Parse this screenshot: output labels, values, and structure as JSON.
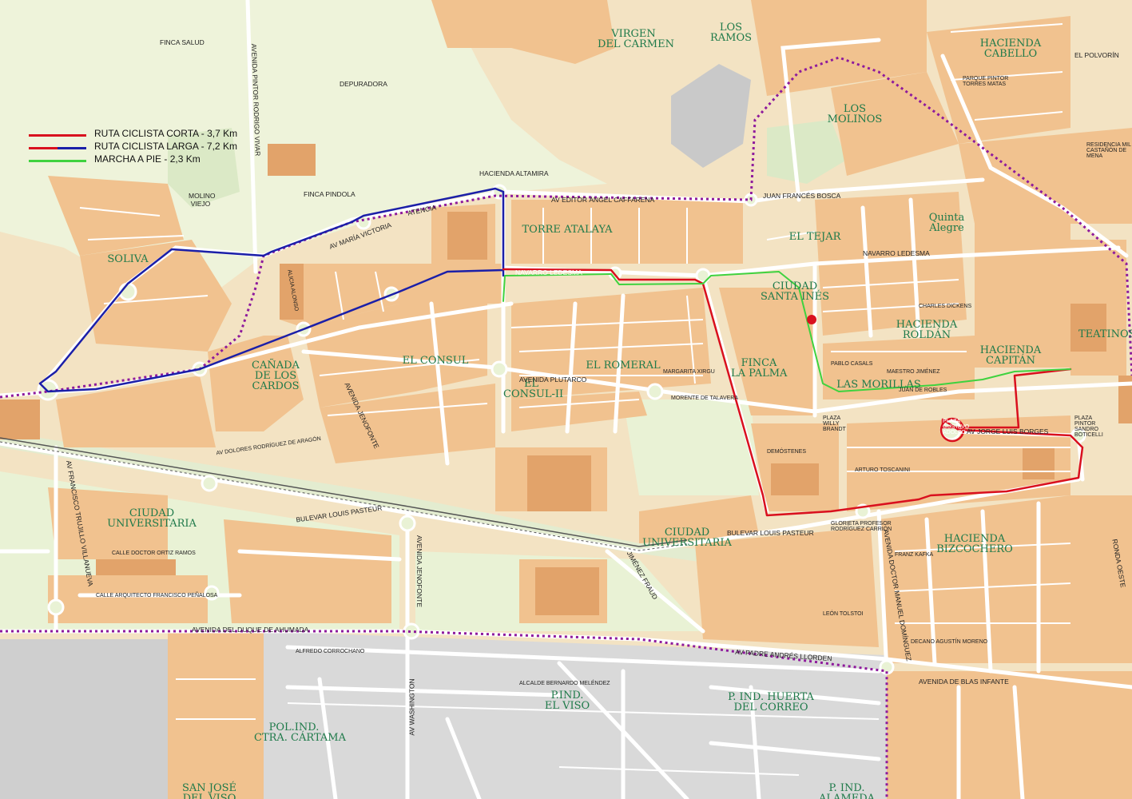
{
  "legend": {
    "items": [
      {
        "label": "RUTA CICLISTA CORTA - 3,7 Km",
        "color": "#d9101e"
      },
      {
        "label": "RUTA CICLISTA LARGA - 7,2 Km",
        "color": "#1b1fa8",
        "color2": "#d9101e"
      },
      {
        "label": "MARCHA A PIE - 2,3 Km",
        "color": "#3fd23f"
      }
    ]
  },
  "colors": {
    "block": "#f1c28f",
    "street": "#ffffff",
    "park": "#e9f2d5",
    "industrial": "#d9d9d9",
    "boundary": "#8e1a9c",
    "district_text": "#1f7a4a",
    "short_route": "#d9101e",
    "long_route": "#1b1fa8",
    "walk_route": "#3fd23f"
  },
  "districts": [
    {
      "name": "VIRGEN\nDEL CARMEN"
    },
    {
      "name": "LOS\nRAMOS"
    },
    {
      "name": "HACIENDA\nCABELLO"
    },
    {
      "name": "LOS\nMOLINOS"
    },
    {
      "name": "SOLIVA"
    },
    {
      "name": "TORRE ATALAYA"
    },
    {
      "name": "EL TEJAR"
    },
    {
      "name": "Quinta\nAlegre"
    },
    {
      "name": "CIUDAD\nSANTA INÉS"
    },
    {
      "name": "EL CONSUL"
    },
    {
      "name": "CAÑADA\nDE LOS\nCARDOS"
    },
    {
      "name": "EL ROMERAL"
    },
    {
      "name": "EL\nCONSUL-II"
    },
    {
      "name": "FINCA\nLA PALMA"
    },
    {
      "name": "LAS MORILLAS"
    },
    {
      "name": "HACIENDA\nROLDÁN"
    },
    {
      "name": "TEATINOS"
    },
    {
      "name": "HACIENDA\nCAPITÁN"
    },
    {
      "name": "CIUDAD\nUNIVERSITARIA"
    },
    {
      "name": "CIUDAD\nUNIVERSITARIA"
    },
    {
      "name": "HACIENDA\nBIZCOCHERO"
    },
    {
      "name": "P.IND.\nEL VISO"
    },
    {
      "name": "P. IND. HUERTA\nDEL CORREO"
    },
    {
      "name": "POL.IND.\nCTRA. CÁRTAMA"
    },
    {
      "name": "SAN JOSÉ\nDEL VISO"
    },
    {
      "name": "P. IND.\nALAMEDA"
    }
  ],
  "streets": [
    {
      "name": "AV EDITOR ÁNGEL CAFFARENA"
    },
    {
      "name": "JUAN FRANCÉS BOSCA"
    },
    {
      "name": "NAVARRO LEDESMA"
    },
    {
      "name": "NAVARRO LEDESMA"
    },
    {
      "name": "AV MARÍA VICTORIA"
    },
    {
      "name": "ATENCIA"
    },
    {
      "name": "AVENIDA PLUTARCO"
    },
    {
      "name": "BULEVAR LOUIS PASTEUR"
    },
    {
      "name": "BULEVAR LOUIS PASTEUR"
    },
    {
      "name": "AVENIDA DEL DUQUE DE AHUMADA"
    },
    {
      "name": "AV PADRE ANDRÉS LLORDEN"
    },
    {
      "name": "AVENIDA DE BLAS INFANTE"
    },
    {
      "name": "AV JORGE LUIS BORGES"
    },
    {
      "name": "AVENIDA JENOFONTE"
    },
    {
      "name": "AVENIDA JENOFONTE"
    },
    {
      "name": "AV FRANCISCO TRUJILLO VILLANUEVA"
    },
    {
      "name": "AV WASHINGTON"
    },
    {
      "name": "AVENIDA DOCTOR MANUEL DOMÍNGUEZ"
    },
    {
      "name": "AVENIDA PINTOR RODRIGO VIVAR"
    },
    {
      "name": "HACIENDA ALTAMIRA"
    },
    {
      "name": "FINCA PINDOLA"
    },
    {
      "name": "FINCA SALUD"
    },
    {
      "name": "DEPURADORA"
    },
    {
      "name": "MOLINO VIEJO"
    },
    {
      "name": "EL POLVORÍN"
    },
    {
      "name": "CALLE DOCTOR ORTIZ RAMOS"
    },
    {
      "name": "CALLE ARQUITECTO FRANCISCO PEÑALOSA"
    },
    {
      "name": "AV DOLORES RODRÍGUEZ DE ARAGÓN"
    },
    {
      "name": "JIMÉNEZ FRAUD"
    },
    {
      "name": "DEMÓSTENES"
    },
    {
      "name": "MORENTE DE TALAVERA"
    },
    {
      "name": "ALICIA ALONSO"
    },
    {
      "name": "ALFREDO CORROCHANO"
    },
    {
      "name": "ALCALDE BERNARDO MELÉNDEZ"
    },
    {
      "name": "MARGARITA XIRGU"
    },
    {
      "name": "ARTURO TOSCANINI"
    },
    {
      "name": "CHARLES DICKENS"
    },
    {
      "name": "PABLO CASALS"
    },
    {
      "name": "LEÓN TOLSTOI"
    },
    {
      "name": "FRANZ KAFKA"
    },
    {
      "name": "DECANO AGUSTÍN MORENO"
    },
    {
      "name": "GLORIETA PROFESOR RODRÍGUEZ CARRIÓN"
    },
    {
      "name": "PLAZA WILLY BRANDT"
    },
    {
      "name": "PLAZA GUSTAVO ADOLFO"
    },
    {
      "name": "PLAZA PINTOR SANDRO BOTICELLI"
    },
    {
      "name": "RONDA OESTE"
    },
    {
      "name": "MAESTRO JIMÉNEZ"
    },
    {
      "name": "JUAN DE ROBLES"
    },
    {
      "name": "PARQUE PINTOR TORRES MATAS"
    },
    {
      "name": "RESIDENCIA MIL CASTAÑÓN DE MENA"
    }
  ]
}
